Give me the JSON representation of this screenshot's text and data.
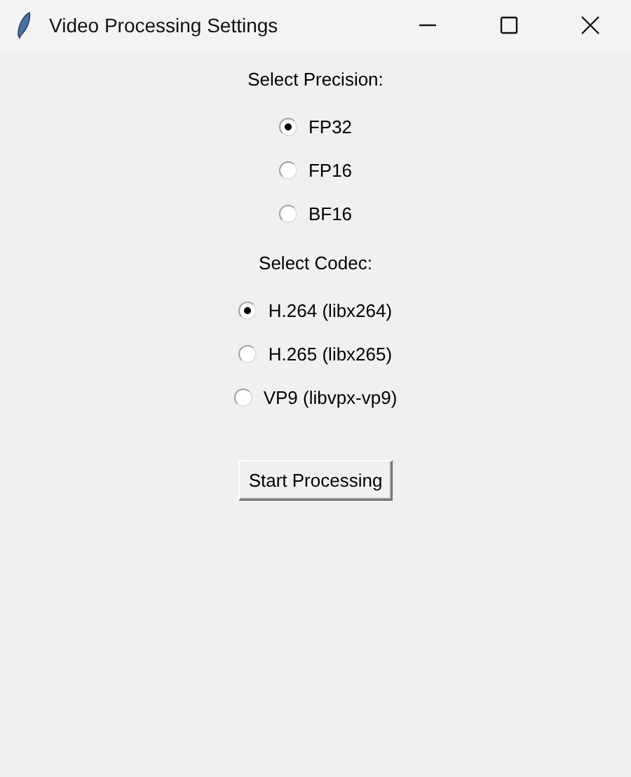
{
  "window": {
    "title": "Video Processing Settings"
  },
  "precision": {
    "label": "Select Precision:",
    "options": [
      {
        "label": "FP32",
        "selected": true
      },
      {
        "label": "FP16",
        "selected": false
      },
      {
        "label": "BF16",
        "selected": false
      }
    ]
  },
  "codec": {
    "label": "Select Codec:",
    "options": [
      {
        "label": "H.264 (libx264)",
        "selected": true
      },
      {
        "label": "H.265 (libx265)",
        "selected": false
      },
      {
        "label": "VP9 (libvpx-vp9)",
        "selected": false
      }
    ]
  },
  "buttons": [
    "Start Processing"
  ]
}
